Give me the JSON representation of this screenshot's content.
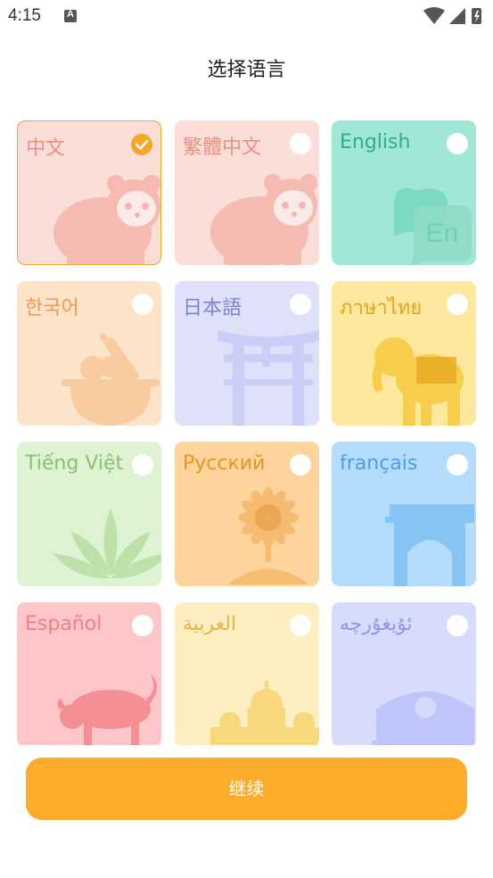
{
  "status_bar": {
    "time": "4:15",
    "notification_icon": "A"
  },
  "title": "选择语言",
  "languages": [
    {
      "label": "中文",
      "selected": true,
      "bg": "#fbded7",
      "text_color": "#ee8f86",
      "art": "panda-icon"
    },
    {
      "label": "繁體中文",
      "selected": false,
      "bg": "#fbded7",
      "text_color": "#ee8f86",
      "art": "panda-icon"
    },
    {
      "label": "English",
      "selected": false,
      "bg": "#a0e7d8",
      "text_color": "#33a98f",
      "art": "chat-bubble-en-icon",
      "art_text": "En"
    },
    {
      "label": "한국어",
      "selected": false,
      "bg": "#fde3c8",
      "text_color": "#f19b52",
      "art": "rice-bowl-icon"
    },
    {
      "label": "日本語",
      "selected": false,
      "bg": "#dfe1fb",
      "text_color": "#7d83d8",
      "art": "torii-gate-icon"
    },
    {
      "label": "ภาษาไทย",
      "selected": false,
      "bg": "#fde89d",
      "text_color": "#e7a421",
      "art": "elephant-icon"
    },
    {
      "label": "Tiếng Việt",
      "selected": false,
      "bg": "#def2d4",
      "text_color": "#8cc26f",
      "art": "lotus-icon"
    },
    {
      "label": "Русский",
      "selected": false,
      "bg": "#fdd49c",
      "text_color": "#e59822",
      "art": "sunflower-icon"
    },
    {
      "label": "français",
      "selected": false,
      "bg": "#b3dcfd",
      "text_color": "#4f9ee7",
      "art": "arch-icon"
    },
    {
      "label": "Español",
      "selected": false,
      "bg": "#fdc7c9",
      "text_color": "#f47e84",
      "art": "bull-icon"
    },
    {
      "label": "العربية",
      "selected": false,
      "bg": "#feefc0",
      "text_color": "#e6b44b",
      "art": "mosque-icon"
    },
    {
      "label": "ئۇيغۇرچە",
      "selected": false,
      "bg": "#d7dcfd",
      "text_color": "#8f97e8",
      "art": "dome-icon"
    }
  ],
  "continue_label": "继续",
  "colors": {
    "accent": "#fdab2b"
  }
}
